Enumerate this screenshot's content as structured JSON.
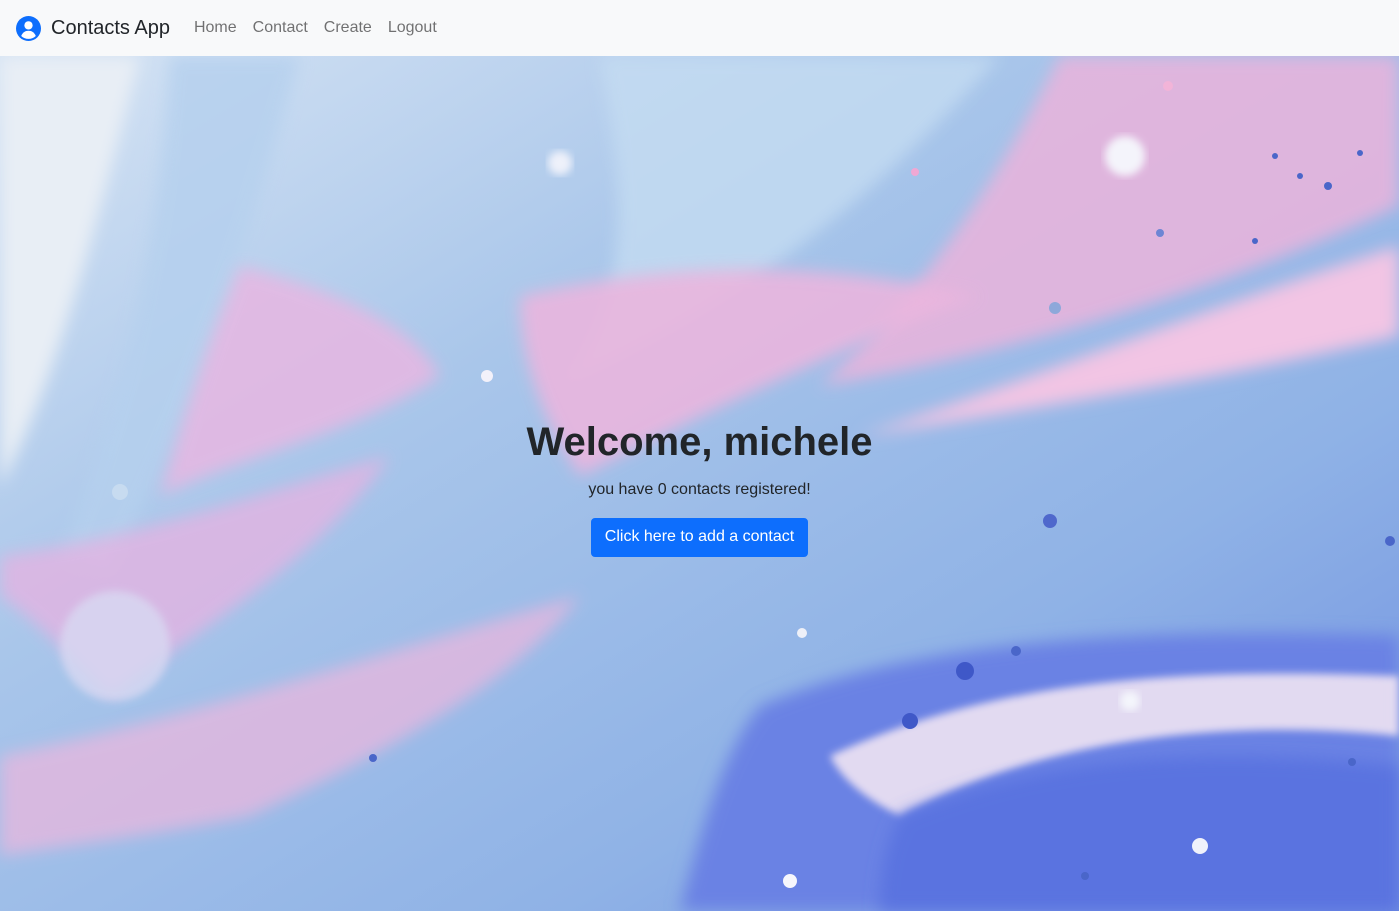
{
  "navbar": {
    "brand_icon": "user-circle-icon",
    "brand_text": "Contacts App",
    "links": [
      "Home",
      "Contact",
      "Create",
      "Logout"
    ]
  },
  "hero": {
    "background": "pink-blue-marbled-fluid-art",
    "welcome": "Welcome, michele",
    "subtitle": "you have 0 contacts registered!",
    "cta_label": "Click here to add a contact"
  },
  "colors": {
    "accent": "#0d6efd",
    "navbar_bg": "#f8f9fa",
    "text": "#212529"
  }
}
